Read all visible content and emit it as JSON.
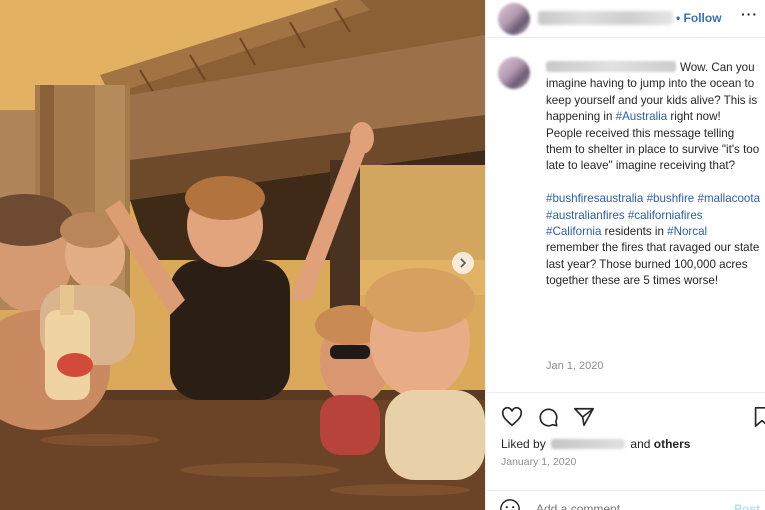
{
  "header": {
    "username": "",
    "follow_separator": "•",
    "follow_label": "Follow",
    "more_label": "···"
  },
  "caption": {
    "username": "",
    "lines": [
      {
        "parts": [
          {
            "text": "Wow. Can you imagine having to jump into the ocean to keep yourself and your kids alive? This is happening in "
          },
          {
            "text": "#Australia",
            "tag": true
          },
          {
            "text": " right now!"
          }
        ]
      },
      {
        "parts": [
          {
            "text": "People received this message telling them to shelter in place to survive \"it's too late to leave\" imagine receiving that?"
          }
        ]
      },
      {
        "parts": [
          {
            "text": ""
          }
        ]
      },
      {
        "parts": [
          {
            "text": "#bushfiresaustralia",
            "tag": true
          },
          {
            "text": " "
          },
          {
            "text": "#bushfire",
            "tag": true
          },
          {
            "text": " "
          },
          {
            "text": "#mallacoota",
            "tag": true
          },
          {
            "text": " "
          },
          {
            "text": "#australianfires",
            "tag": true
          },
          {
            "text": " "
          },
          {
            "text": "#californiafires",
            "tag": true
          }
        ]
      },
      {
        "parts": [
          {
            "text": "#California",
            "tag": true
          },
          {
            "text": " residents in "
          },
          {
            "text": "#Norcal",
            "tag": true
          },
          {
            "text": " remember the fires that ravaged our state last year? Those burned 100,000 acres together these are 5 times worse!"
          }
        ]
      }
    ],
    "date": "Jan 1, 2020"
  },
  "actions": {
    "icons": [
      "heart-icon",
      "comment-icon",
      "share-icon",
      "bookmark-icon"
    ]
  },
  "likes": {
    "prefix": "Liked by",
    "suffix": "and",
    "others": "others"
  },
  "post_date": "January 1, 2020",
  "comment": {
    "placeholder": "Add a comment...",
    "post_label": "Post"
  },
  "colors": {
    "link": "#2b5fa8",
    "follow": "#3b6fb6",
    "muted": "#8e8e8e"
  }
}
